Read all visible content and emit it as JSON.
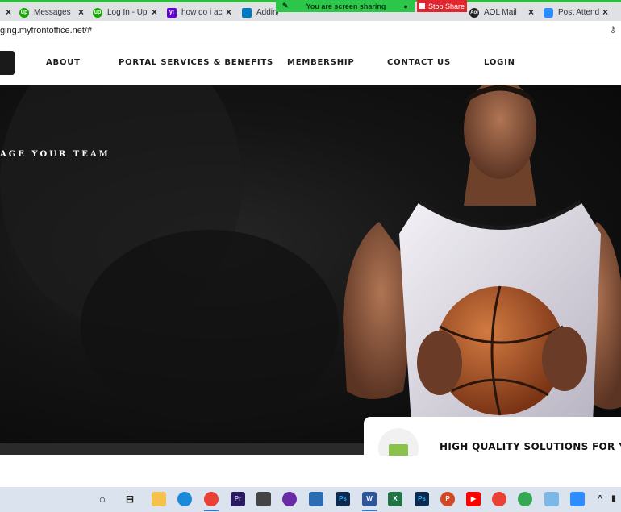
{
  "browser": {
    "tabs": [
      {
        "label": "Messages",
        "icon": "upwork-icon"
      },
      {
        "label": "Log In - Up",
        "icon": "upwork-icon"
      },
      {
        "label": "how do i ac",
        "icon": "yahoo-icon"
      },
      {
        "label": "Adding",
        "icon": "trello-icon"
      },
      {
        "label": "AOL Mail",
        "icon": "aol-icon"
      },
      {
        "label": "Post Attend",
        "icon": "zoom-icon"
      }
    ],
    "url": "ging.myfrontoffice.net/#",
    "share_banner": {
      "status": "You are screen sharing",
      "stop_label": "Stop Share"
    }
  },
  "nav": {
    "items": [
      "ABOUT",
      "PORTAL SERVICES & BENEFITS",
      "MEMBERSHIP",
      "CONTACT US",
      "LOGIN"
    ]
  },
  "hero": {
    "tagline": "AGE YOUR TEAM"
  },
  "feature_card": {
    "title": "HIGH QUALITY SOLUTIONS FOR YOU"
  },
  "colors": {
    "share_green": "#2cc64a",
    "share_red": "#e0262e",
    "card_accent": "#8bc34a"
  },
  "taskbar": {
    "icons": [
      "cortana-icon",
      "task-view-icon",
      "file-explorer-icon",
      "edge-icon",
      "chrome-icon",
      "premiere-icon",
      "store-icon",
      "app-icon",
      "mail-icon",
      "photoshop-icon",
      "word-icon",
      "excel-icon",
      "photoshop-icon",
      "powerpoint-icon",
      "youtube-icon",
      "chrome-icon",
      "chrome-icon",
      "notes-icon",
      "zoom-icon"
    ]
  }
}
